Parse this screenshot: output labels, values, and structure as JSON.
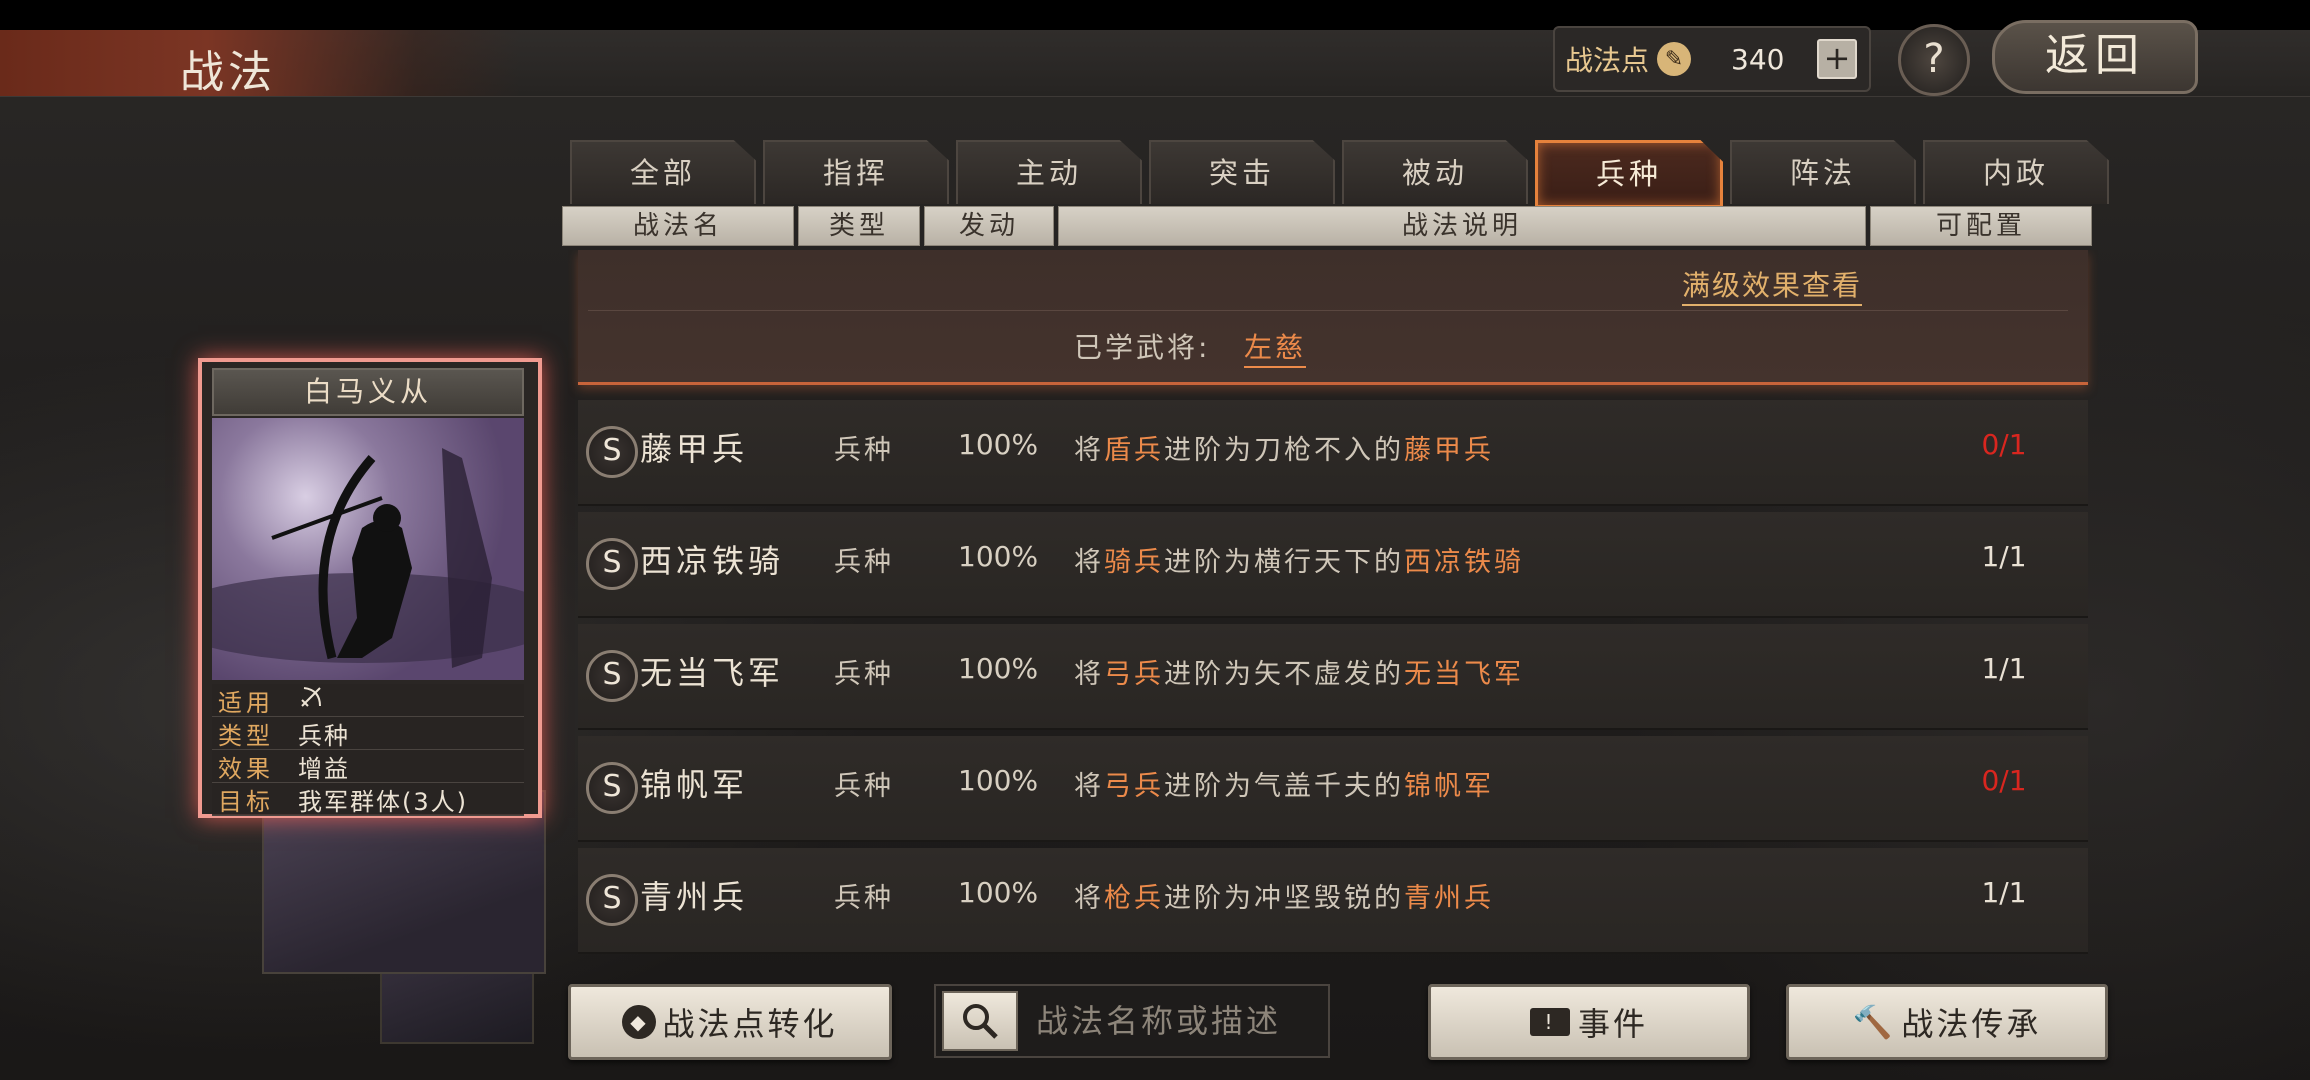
{
  "header": {
    "title": "战法",
    "points_label": "战法点",
    "points_value": "340",
    "plus_label": "+",
    "help_label": "?",
    "back_label": "返回"
  },
  "tabs": [
    {
      "label": "全部",
      "active": false
    },
    {
      "label": "指挥",
      "active": false
    },
    {
      "label": "主动",
      "active": false
    },
    {
      "label": "突击",
      "active": false
    },
    {
      "label": "被动",
      "active": false
    },
    {
      "label": "兵种",
      "active": true
    },
    {
      "label": "阵法",
      "active": false
    },
    {
      "label": "内政",
      "active": false
    }
  ],
  "columns": [
    "战法名",
    "类型",
    "发动",
    "战法说明",
    "可配置"
  ],
  "expanded": {
    "max_level_link": "满级效果查看",
    "learned_label": "已学武将:",
    "learned_general": "左慈"
  },
  "rows": [
    {
      "grade": "S",
      "name": "藤甲兵",
      "type": "兵种",
      "rate": "100%",
      "desc": [
        "将",
        "盾兵",
        "进阶为刀枪不入的",
        "藤甲兵"
      ],
      "count": "0/1",
      "count_color": "red"
    },
    {
      "grade": "S",
      "name": "西凉铁骑",
      "type": "兵种",
      "rate": "100%",
      "desc": [
        "将",
        "骑兵",
        "进阶为横行天下的",
        "西凉铁骑"
      ],
      "count": "1/1",
      "count_color": "normal"
    },
    {
      "grade": "S",
      "name": "无当飞军",
      "type": "兵种",
      "rate": "100%",
      "desc": [
        "将",
        "弓兵",
        "进阶为矢不虚发的",
        "无当飞军"
      ],
      "count": "1/1",
      "count_color": "normal"
    },
    {
      "grade": "S",
      "name": "锦帆军",
      "type": "兵种",
      "rate": "100%",
      "desc": [
        "将",
        "弓兵",
        "进阶为气盖千夫的",
        "锦帆军"
      ],
      "count": "0/1",
      "count_color": "red"
    },
    {
      "grade": "S",
      "name": "青州兵",
      "type": "兵种",
      "rate": "100%",
      "desc": [
        "将",
        "枪兵",
        "进阶为冲坚毁锐的",
        "青州兵"
      ],
      "count": "1/1",
      "count_color": "normal"
    }
  ],
  "card": {
    "title": "白马义从",
    "stats": [
      {
        "key": "适用",
        "value": "bow-icon"
      },
      {
        "key": "类型",
        "value": "兵种"
      },
      {
        "key": "效果",
        "value": "增益"
      },
      {
        "key": "目标",
        "value": "我军群体(3人)"
      }
    ]
  },
  "bottom": {
    "convert_label": "战法点转化",
    "search_placeholder": "战法名称或描述",
    "event_label": "事件",
    "inherit_label": "战法传承"
  },
  "colors": {
    "accent": "#ec8a4a",
    "active_tab_border": "#e5823c",
    "count_red": "#d9261f",
    "card_glow": "#f09a90"
  }
}
